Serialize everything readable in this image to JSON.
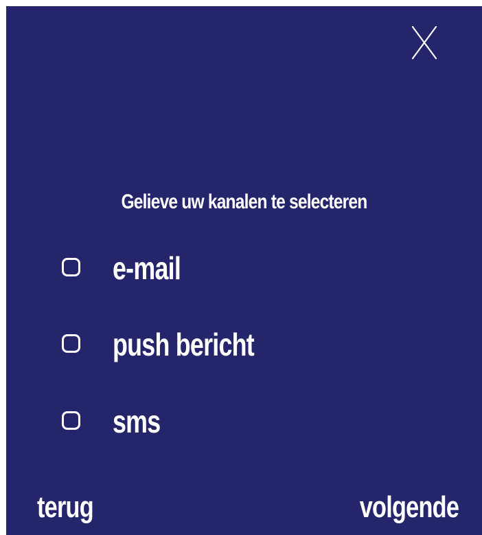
{
  "dialog": {
    "close_icon": "close-icon",
    "title": "Gelieve uw kanalen te selecteren"
  },
  "options": [
    {
      "label": "e-mail",
      "checked": false
    },
    {
      "label": "push bericht",
      "checked": false
    },
    {
      "label": "sms",
      "checked": false
    }
  ],
  "navigation": {
    "back_label": "terug",
    "next_label": "volgende"
  },
  "colors": {
    "background": "#24256b",
    "foreground": "#ffffff"
  }
}
